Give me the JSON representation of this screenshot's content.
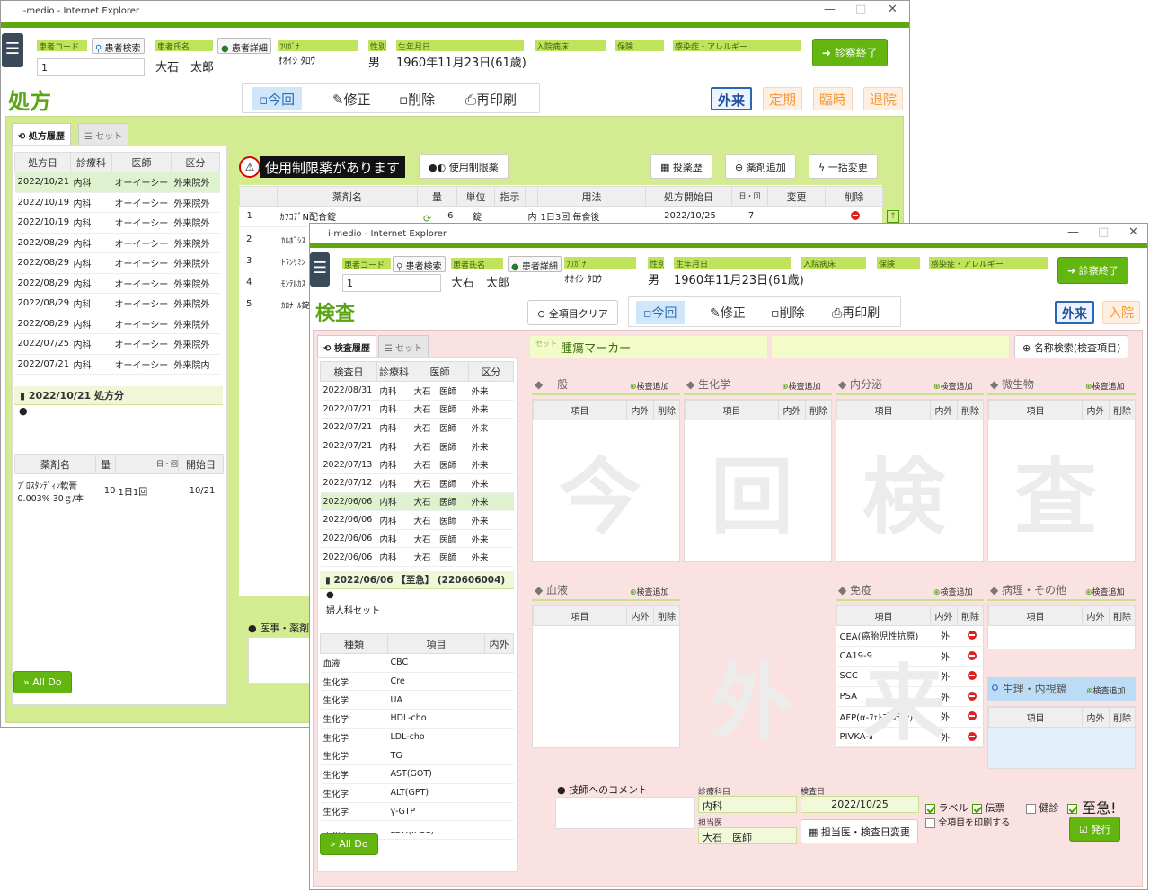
{
  "back": {
    "title": "i-medio - Internet Explorer",
    "controls": [
      "—",
      "□",
      "✕"
    ],
    "patient": {
      "code_label": "患者コード",
      "code_value": "1",
      "search_btn": "患者検索",
      "name_label": "患者氏名",
      "name_value": "大石　太郎",
      "detail_btn": "患者詳細",
      "kana_label": "ﾌﾘｶﾞﾅ",
      "kana_value": "ｵｵｲｼ ﾀﾛｳ",
      "sex_label": "性別",
      "sex_value": "男",
      "dob_label": "生年月日",
      "dob_value": "1960年11月23日(61歳)",
      "ward_label": "入院病床",
      "ins_label": "保険",
      "allergy_label": "感染症・アレルギー"
    },
    "end_btn": "診察終了",
    "page_title": "処方",
    "tabs": [
      "今回",
      "修正",
      "削除",
      "再印刷"
    ],
    "modes": [
      "外来",
      "定期",
      "臨時",
      "退院"
    ],
    "left_tabs": [
      "処方履歴",
      "セット"
    ],
    "history_headers": [
      "処方日",
      "診療科",
      "医師",
      "区分"
    ],
    "history_rows": [
      [
        "2022/10/21",
        "内科",
        "オーイーシー",
        "外来院外"
      ],
      [
        "2022/10/19",
        "内科",
        "オーイーシー",
        "外来院外"
      ],
      [
        "2022/10/19",
        "内科",
        "オーイーシー",
        "外来院外"
      ],
      [
        "2022/08/29",
        "内科",
        "オーイーシー",
        "外来院外"
      ],
      [
        "2022/08/29",
        "内科",
        "オーイーシー",
        "外来院外"
      ],
      [
        "2022/08/29",
        "内科",
        "オーイーシー",
        "外来院外"
      ],
      [
        "2022/08/29",
        "内科",
        "オーイーシー",
        "外来院外"
      ],
      [
        "2022/08/29",
        "内科",
        "オーイーシー",
        "外来院外"
      ],
      [
        "2022/07/25",
        "内科",
        "オーイーシー",
        "外来院外"
      ],
      [
        "2022/07/21",
        "内科",
        "オーイーシー",
        "外来院内"
      ]
    ],
    "detail_title": "2022/10/21 処方分",
    "drug_headers": [
      "薬剤名",
      "量",
      "日・回",
      "開始日"
    ],
    "drug_row": [
      "ﾌﾟﾛｽﾀﾝﾃﾞｨﾝ軟膏0.003% 30ｇ/本",
      "10",
      "1日1回",
      "10/21"
    ],
    "alldo": "All Do",
    "warning": "使用制限薬があります",
    "restricted_btn": "使用制限薬",
    "tool_btns": [
      "投薬歴",
      "薬剤追加",
      "一括変更"
    ],
    "rx_headers": [
      "",
      "薬剤名",
      "量",
      "単位",
      "指示",
      "",
      "用法",
      "処方開始日",
      "日・回",
      "変更",
      "削除"
    ],
    "rx_row1": [
      "1",
      "ｶﾌｺﾃﾞN配合錠",
      "6",
      "錠",
      "内",
      "1日3回 毎食後",
      "2022/10/25",
      "7"
    ],
    "rx_more": [
      [
        "2",
        "ｶﾙﾎﾞｼｽ"
      ],
      [
        "3",
        "ﾄﾗﾝｻﾐﾝ"
      ],
      [
        "4",
        "ﾓﾝﾃﾙｶｽ"
      ],
      [
        "5",
        "ｶﾛﾅｰﾙ錠"
      ]
    ],
    "comment_label": "医事・薬剤"
  },
  "front": {
    "title": "i-medio - Internet Explorer",
    "controls": [
      "—",
      "□",
      "✕"
    ],
    "patient": {
      "code_label": "患者コード",
      "code_value": "1",
      "search_btn": "患者検索",
      "name_label": "患者氏名",
      "name_value": "大石　太郎",
      "detail_btn": "患者詳細",
      "kana_label": "ﾌﾘｶﾞﾅ",
      "kana_value": "ｵｵｲｼ ﾀﾛｳ",
      "sex_label": "性別",
      "sex_value": "男",
      "dob_label": "生年月日",
      "dob_value": "1960年11月23日(61歳)",
      "ward_label": "入院病床",
      "ins_label": "保険",
      "allergy_label": "感染症・アレルギー"
    },
    "end_btn": "診察終了",
    "page_title": "検査",
    "clear_btn": "全項目クリア",
    "tabs": [
      "今回",
      "修正",
      "削除",
      "再印刷"
    ],
    "modes": [
      "外来",
      "入院"
    ],
    "left_tabs": [
      "検査履歴",
      "セット"
    ],
    "history_headers": [
      "検査日",
      "診療科",
      "医師",
      "区分"
    ],
    "history_rows": [
      [
        "2022/08/31",
        "内科",
        "大石　医師",
        "外来"
      ],
      [
        "2022/07/21",
        "内科",
        "大石　医師",
        "外来"
      ],
      [
        "2022/07/21",
        "内科",
        "大石　医師",
        "外来"
      ],
      [
        "2022/07/21",
        "内科",
        "大石　医師",
        "外来"
      ],
      [
        "2022/07/13",
        "内科",
        "大石　医師",
        "外来"
      ],
      [
        "2022/07/12",
        "内科",
        "大石　医師",
        "外来"
      ],
      [
        "2022/06/06",
        "内科",
        "大石　医師",
        "外来"
      ],
      [
        "2022/06/06",
        "内科",
        "大石　医師",
        "外来"
      ],
      [
        "2022/06/06",
        "内科",
        "大石　医師",
        "外来"
      ],
      [
        "2022/06/06",
        "内科",
        "大石　医師",
        "外来"
      ]
    ],
    "detail_title": "2022/06/06 【至急】 (220606004)",
    "detail_set": "婦人科セット",
    "item_headers": [
      "種類",
      "項目",
      "内外"
    ],
    "item_rows": [
      [
        "血液",
        "CBC"
      ],
      [
        "生化学",
        "Cre"
      ],
      [
        "生化学",
        "UA"
      ],
      [
        "生化学",
        "HDL-cho"
      ],
      [
        "生化学",
        "LDL-cho"
      ],
      [
        "生化学",
        "TG"
      ],
      [
        "生化学",
        "AST(GOT)"
      ],
      [
        "生化学",
        "ALT(GPT)"
      ],
      [
        "生化学",
        "γ-GTP"
      ],
      [
        "生化学",
        "LDH(IFCC)"
      ]
    ],
    "alldo": "All Do",
    "set_small": "セット",
    "set_name": "腫瘍マーカー",
    "name_search_btn": "名称検索(検査項目)",
    "add_label": "検査追加",
    "cat_headers": [
      "項目",
      "内外",
      "削除"
    ],
    "categories": [
      "一般",
      "生化学",
      "内分泌",
      "微生物",
      "血液",
      "免疫",
      "病理・その他",
      "生理・内視鏡"
    ],
    "immune_rows": [
      [
        "CEA(癌胎児性抗原)",
        "外"
      ],
      [
        "CA19-9",
        "外"
      ],
      [
        "SCC",
        "外"
      ],
      [
        "PSA",
        "外"
      ],
      [
        "AFP(α-ﾌｪﾄﾌﾟﾛﾃｲﾝ)",
        "外"
      ],
      [
        "PIVKA-Ⅱ",
        "外"
      ]
    ],
    "watermark1": [
      "今",
      "回",
      "検",
      "査"
    ],
    "watermark2": [
      "外",
      "来"
    ],
    "tech_comment_label": "技師へのコメント",
    "dept_label": "診療科目",
    "dept_value": "内科",
    "exam_date_label": "検査日",
    "exam_date_value": "2022/10/25",
    "doctor_label": "担当医",
    "doctor_value": "大石　医師",
    "change_btn": "担当医・検査日変更",
    "opt_label": "ラベル",
    "opt_slip": "伝票",
    "opt_checkup": "健診",
    "opt_urgent": "至急!",
    "opt_printall": "全項目を印刷する",
    "issue_btn": "発行"
  }
}
